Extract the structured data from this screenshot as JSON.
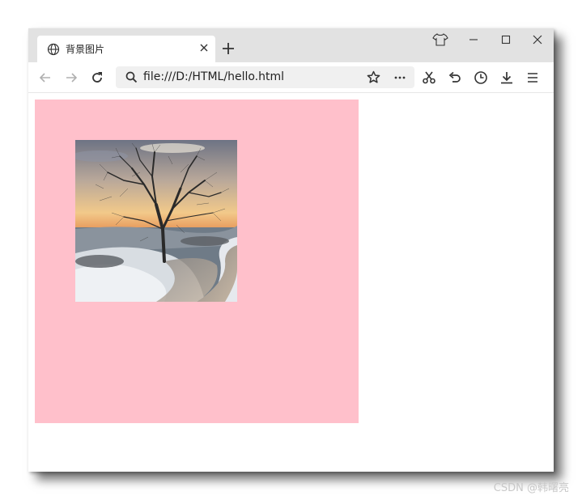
{
  "browser": {
    "tab_title": "背景图片",
    "address": "file:///D:/HTML/hello.html",
    "icons": [
      "globe-icon",
      "close-icon",
      "plus-icon",
      "shirt-icon",
      "minimize-icon",
      "maximize-icon",
      "window-close-icon",
      "back-icon",
      "forward-icon",
      "reload-icon",
      "search-icon",
      "star-icon",
      "more-icon",
      "scissors-icon",
      "undo-icon",
      "history-icon",
      "download-icon",
      "menu-icon"
    ]
  },
  "page": {
    "box_color": "#ffc0cb",
    "image_subject": "snowy tree by road at sunset"
  },
  "watermark": "CSDN @韩曙亮"
}
